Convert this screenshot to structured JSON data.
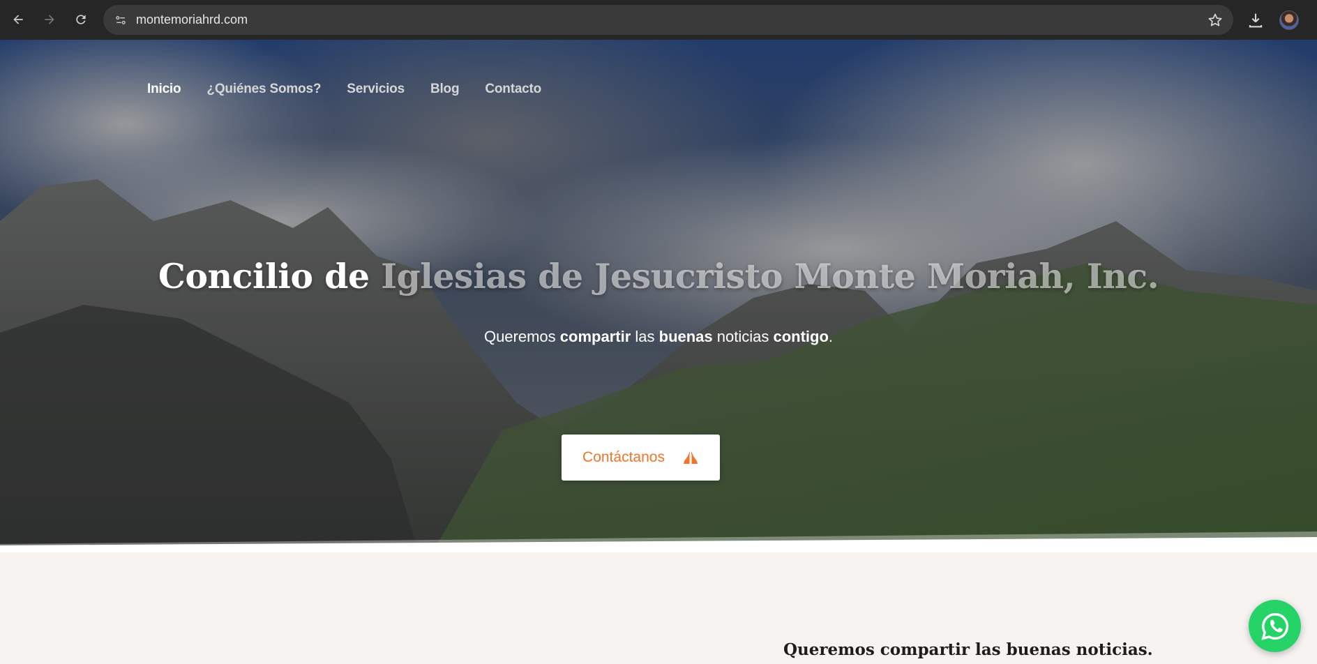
{
  "browser": {
    "url": "montemoriahrd.com",
    "icons": [
      "back-arrow-icon",
      "forward-arrow-icon",
      "reload-icon",
      "site-info-icon",
      "bookmark-star-icon",
      "download-icon",
      "profile-avatar"
    ]
  },
  "site_nav": {
    "items": [
      {
        "label": "Inicio",
        "active": true
      },
      {
        "label": "¿Quiénes Somos?",
        "active": false
      },
      {
        "label": "Servicios",
        "active": false
      },
      {
        "label": "Blog",
        "active": false
      },
      {
        "label": "Contacto",
        "active": false
      }
    ]
  },
  "hero": {
    "title_part1": "Concilio de ",
    "title_part2": "Iglesias de Jesucristo Monte Moriah, Inc.",
    "tagline": {
      "t1": "Queremos ",
      "b1": "compartir",
      "t2": " las ",
      "b2": "buenas",
      "t3": " noticias ",
      "b3": "contigo",
      "t4": "."
    },
    "cta_label": "Contáctanos",
    "cta_icon": "praying-hands-icon"
  },
  "section": {
    "heading": "Queremos compartir las buenas noticias."
  },
  "floating": {
    "icon": "whatsapp-icon"
  },
  "colors": {
    "accent": "#f0752b",
    "whatsapp": "#25d366",
    "chrome_bg": "#262626",
    "section_bg": "#f6f3f1"
  }
}
